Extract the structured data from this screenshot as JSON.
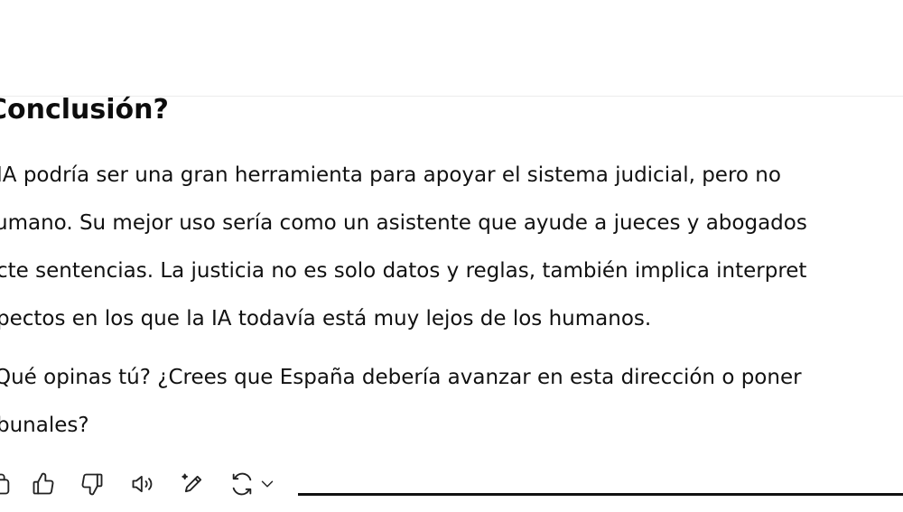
{
  "message": {
    "heading": "Conclusión?",
    "paragraph1": [
      " IA podría ser una gran herramienta para apoyar el sistema judicial, pero no",
      "umano. Su mejor uso sería como un asistente que ayude a jueces y abogados",
      "cte sentencias. La justicia no es solo datos y reglas, también implica interpret",
      "pectos en los que la IA todavía está muy lejos de los humanos."
    ],
    "paragraph2": [
      "Qué opinas tú? ¿Crees que España debería avanzar en esta dirección o poner",
      "bunales?"
    ]
  },
  "toolbar": {
    "icons": [
      "copy-icon",
      "thumbs-up-icon",
      "thumbs-down-icon",
      "read-aloud-icon",
      "edit-icon",
      "regenerate-icon",
      "chevron-down-icon"
    ]
  }
}
